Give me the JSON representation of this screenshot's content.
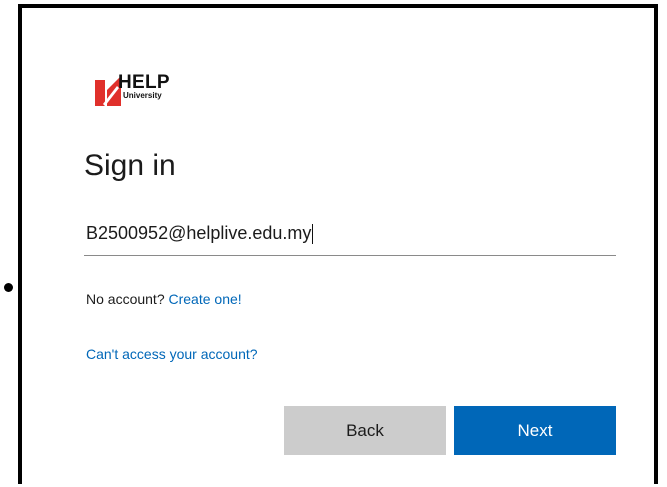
{
  "logo": {
    "name": "HELP",
    "sub": "University",
    "colors": {
      "red": "#e0302b",
      "dark": "#111111"
    }
  },
  "signin": {
    "title": "Sign in",
    "email_value": "B2500952@helplive.edu.my",
    "no_account_text": "No account?",
    "create_link": "Create one!",
    "cant_access_link": "Can't access your account?"
  },
  "buttons": {
    "back": "Back",
    "next": "Next"
  },
  "colors": {
    "accent": "#0067b8",
    "back_button": "#cccccc"
  }
}
